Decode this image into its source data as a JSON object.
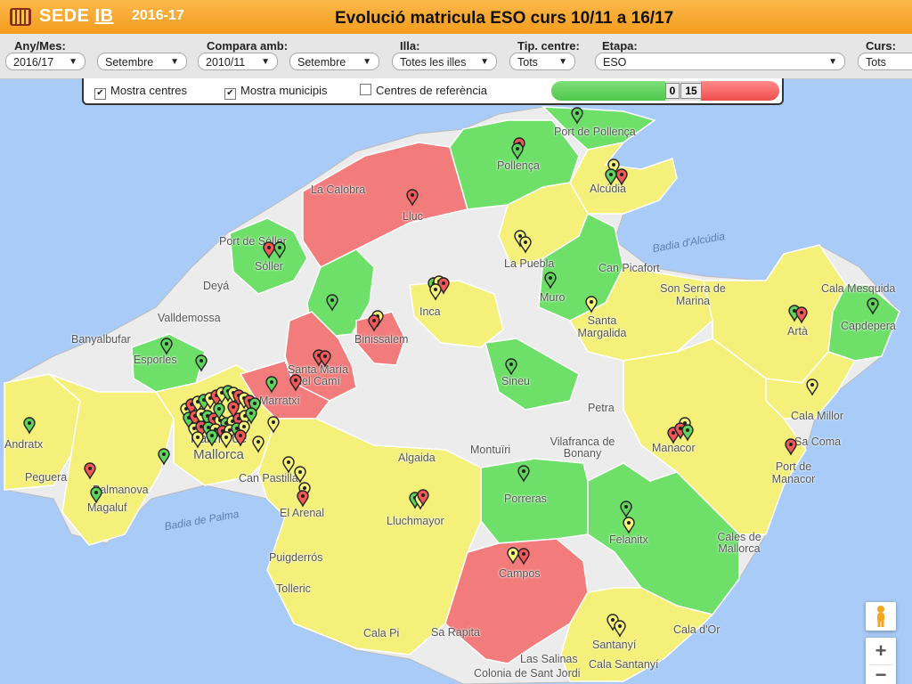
{
  "header": {
    "brand": "SEDE",
    "brand_suffix": "IB",
    "year": "2016-17",
    "title": "Evolució matricula ESO curs 10/11 a 16/17"
  },
  "filters": {
    "any_mes_label": "Any/Mes:",
    "any_value": "2016/17",
    "mes_value": "Setembre",
    "compara_label": "Compara amb:",
    "compara_any": "2010/11",
    "compara_mes": "Setembre",
    "illa_label": "Illa:",
    "illa_value": "Totes les illes",
    "tip_label": "Tip. centre:",
    "tip_value": "Tots",
    "etapa_label": "Etapa:",
    "etapa_value": "ESO",
    "curs_label": "Curs:",
    "curs_value": "Tots"
  },
  "toolbar": {
    "mostra_centres": "Mostra centres",
    "mostra_municipis": "Mostra municipis",
    "centres_referencia": "Centres de referència",
    "range_min": "0",
    "range_max": "15"
  },
  "colors": {
    "green": "#6ee06a",
    "yellow": "#f4f07a",
    "red": "#f27c7c",
    "gray": "#ececec",
    "sea": "#a9cbf8",
    "header": "#f5a623"
  },
  "places": [
    {
      "name": "Port de Pollença"
    },
    {
      "name": "Pollença"
    },
    {
      "name": "Alcúdia"
    },
    {
      "name": "La Calobra"
    },
    {
      "name": "Lluc"
    },
    {
      "name": "Port de Sóller"
    },
    {
      "name": "Sóller"
    },
    {
      "name": "Deyá"
    },
    {
      "name": "Valldemossa"
    },
    {
      "name": "Banyalbufar"
    },
    {
      "name": "Esporles"
    },
    {
      "name": "La Puebla"
    },
    {
      "name": "Can Picafort"
    },
    {
      "name": "Muro"
    },
    {
      "name": "Inca"
    },
    {
      "name": "Binissalem"
    },
    {
      "name": "Santa María del Camí"
    },
    {
      "name": "Marratxí"
    },
    {
      "name": "Santa Margalida"
    },
    {
      "name": "Son Serra de Marina"
    },
    {
      "name": "Artà"
    },
    {
      "name": "Capdepera"
    },
    {
      "name": "Cala Mesquida"
    },
    {
      "name": "Sineu"
    },
    {
      "name": "Petra"
    },
    {
      "name": "Cala Millor"
    },
    {
      "name": "Sa Coma"
    },
    {
      "name": "Manacor"
    },
    {
      "name": "Port de Manacor"
    },
    {
      "name": "Andratx"
    },
    {
      "name": "Peguera"
    },
    {
      "name": "Palmanova"
    },
    {
      "name": "Magaluf"
    },
    {
      "name": "Palma de Mallorca"
    },
    {
      "name": "Can Pastilla"
    },
    {
      "name": "El Arenal"
    },
    {
      "name": "Algaida"
    },
    {
      "name": "Montuïri"
    },
    {
      "name": "Vilafranca de Bonany"
    },
    {
      "name": "Porreras"
    },
    {
      "name": "Lluchmayor"
    },
    {
      "name": "Felanitx"
    },
    {
      "name": "Cales de Mallorca"
    },
    {
      "name": "Puigderrós"
    },
    {
      "name": "Tolleric"
    },
    {
      "name": "Campos"
    },
    {
      "name": "Cala Pi"
    },
    {
      "name": "Sa Rapita"
    },
    {
      "name": "Santanyí"
    },
    {
      "name": "Cala d'Or"
    },
    {
      "name": "Las Salinas"
    },
    {
      "name": "Cala Santanyí"
    },
    {
      "name": "Colonia de Sant Jordi"
    }
  ],
  "seas": {
    "badia_alcudia": "Badia d'Alcúdia",
    "badia_palma": "Badia de Palma"
  }
}
